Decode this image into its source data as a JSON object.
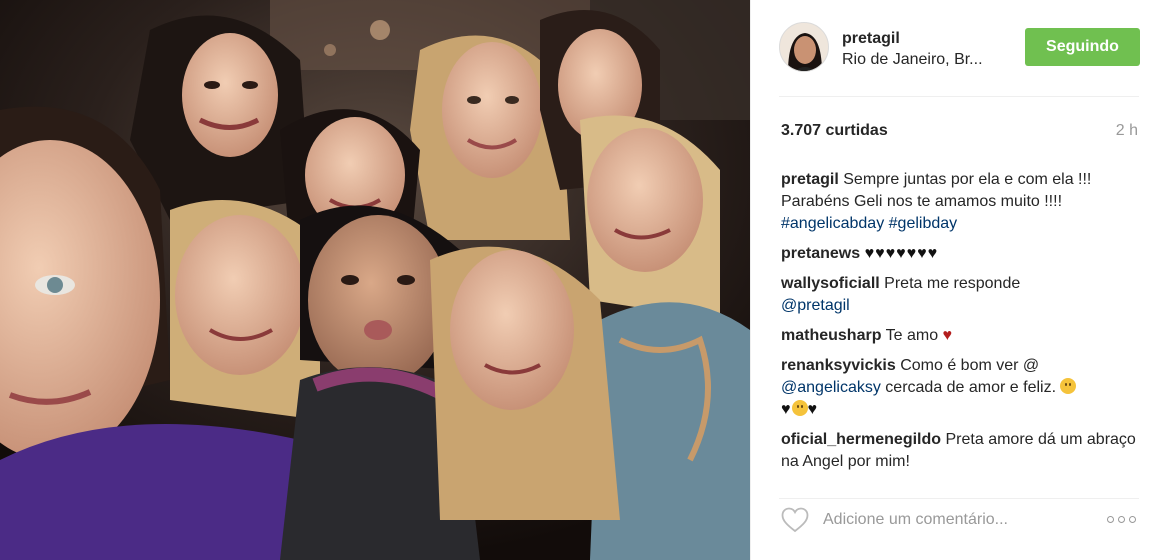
{
  "post": {
    "username": "pretagil",
    "location": "Rio de Janeiro, Br...",
    "follow_label": "Seguindo",
    "likes": "3.707 curtidas",
    "time_ago": "2 h",
    "caption": {
      "user": "pretagil",
      "text": "Sempre juntas por ela e com ela !!! Parabéns Geli nos te amamos muito !!!! ",
      "tags": [
        "#angelicabday",
        "#gelibday"
      ]
    },
    "comments": [
      {
        "user": "pretanews",
        "text": "♥♥♥♥♥♥♥"
      },
      {
        "user": "wallysoficiall",
        "text": "Preta me responde ",
        "mention": "@pretagil"
      },
      {
        "user": "matheusharp",
        "text": "Te amo ",
        "emoji": "♥"
      },
      {
        "user": "renanksyvickis",
        "text_before": "Como é bom ver @ ",
        "mention": "@angelicaksy",
        "text_after": " cercada de amor e feliz. ",
        "hearts_end": "♥",
        "hearts_mid": "♥"
      },
      {
        "user": "oficial_hermenegildo",
        "text": "Preta amore dá um abraço na Angel por mim!"
      }
    ],
    "comment_placeholder": "Adicione um comentário...",
    "icons": {
      "like": "heart-outline-icon",
      "more": "more-options-icon"
    },
    "colors": {
      "follow_button": "#70c050",
      "hashtag": "#003569",
      "muted": "#999999"
    }
  }
}
